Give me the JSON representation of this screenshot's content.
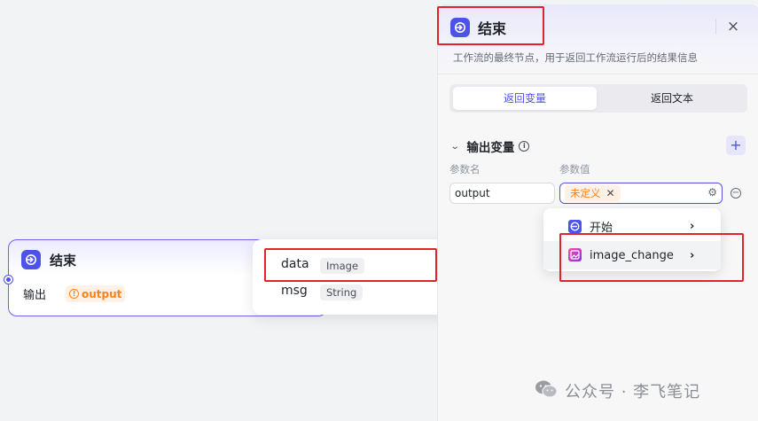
{
  "node": {
    "title": "结束",
    "output_label": "输出",
    "output_tag": "output"
  },
  "variables_popover": {
    "items": [
      {
        "name": "data",
        "type": "Image"
      },
      {
        "name": "msg",
        "type": "String"
      }
    ]
  },
  "panel": {
    "title": "结束",
    "description": "工作流的最终节点，用于返回工作流运行后的结果信息",
    "close_icon": "×",
    "tabs": [
      {
        "label": "返回变量",
        "active": true
      },
      {
        "label": "返回文本",
        "active": false
      }
    ],
    "output_section": {
      "title": "输出变量",
      "col_name": "参数名",
      "col_value": "参数值",
      "row": {
        "name": "output",
        "value_tag": "未定义"
      }
    }
  },
  "dropdown": {
    "items": [
      {
        "label": "开始",
        "icon": "start-icon"
      },
      {
        "label": "image_change",
        "icon": "image-plugin-icon"
      }
    ]
  },
  "watermark": {
    "text": "公众号 · 李飞笔记"
  },
  "colors": {
    "accent": "#4d53e8",
    "warning": "#ff811a",
    "highlight": "#e3232b"
  }
}
